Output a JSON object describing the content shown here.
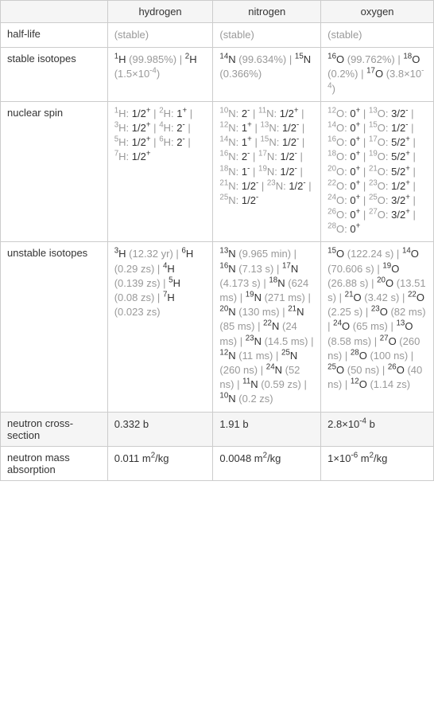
{
  "headers": {
    "hydrogen": "hydrogen",
    "nitrogen": "nitrogen",
    "oxygen": "oxygen"
  },
  "rows": {
    "half_life": {
      "label": "half-life",
      "hydrogen": "(stable)",
      "nitrogen": "(stable)",
      "oxygen": "(stable)"
    },
    "stable_isotopes": {
      "label": "stable isotopes",
      "hydrogen": "¹H (99.985%) | ²H (1.5×10⁻⁴)",
      "nitrogen": "¹⁴N (99.634%) | ¹⁵N (0.366%)",
      "oxygen": "¹⁶O (99.762%) | ¹⁸O (0.2%) | ¹⁷O (3.8×10⁻⁴)"
    },
    "nuclear_spin": {
      "label": "nuclear spin",
      "hydrogen": "¹H: 1/2⁺ | ²H: 1⁺ | ³H: 1/2⁺ | ⁴H: 2⁻ | ⁵H: 1/2⁺ | ⁶H: 2⁻ | ⁷H: 1/2⁺",
      "nitrogen": "¹⁰N: 2⁻ | ¹¹N: 1/2⁺ | ¹²N: 1⁺ | ¹³N: 1/2⁻ | ¹⁴N: 1⁺ | ¹⁵N: 1/2⁻ | ¹⁶N: 2⁻ | ¹⁷N: 1/2⁻ | ¹⁸N: 1⁻ | ¹⁹N: 1/2⁻ | ²¹N: 1/2⁻ | ²³N: 1/2⁻ | ²⁵N: 1/2⁻",
      "oxygen": "¹²O: 0⁺ | ¹³O: 3/2⁻ | ¹⁴O: 0⁺ | ¹⁵O: 1/2⁻ | ¹⁶O: 0⁺ | ¹⁷O: 5/2⁺ | ¹⁸O: 0⁺ | ¹⁹O: 5/2⁺ | ²⁰O: 0⁺ | ²¹O: 5/2⁺ | ²²O: 0⁺ | ²³O: 1/2⁺ | ²⁴O: 0⁺ | ²⁵O: 3/2⁺ | ²⁶O: 0⁺ | ²⁷O: 3/2⁺ | ²⁸O: 0⁺"
    },
    "unstable_isotopes": {
      "label": "unstable isotopes",
      "hydrogen": "³H (12.32 yr) | ⁶H (0.29 zs) | ⁴H (0.139 zs) | ⁵H (0.08 zs) | ⁷H (0.023 zs)",
      "nitrogen": "¹³N (9.965 min) | ¹⁶N (7.13 s) | ¹⁷N (4.173 s) | ¹⁸N (624 ms) | ¹⁹N (271 ms) | ²⁰N (130 ms) | ²¹N (85 ms) | ²²N (24 ms) | ²³N (14.5 ms) | ¹²N (11 ms) | ²⁵N (260 ns) | ²⁴N (52 ns) | ¹¹N (0.59 zs) | ¹⁰N (0.2 zs)",
      "oxygen": "¹⁵O (122.24 s) | ¹⁴O (70.606 s) | ¹⁹O (26.88 s) | ²⁰O (13.51 s) | ²¹O (3.42 s) | ²²O (2.25 s) | ²³O (82 ms) | ²⁴O (65 ms) | ¹³O (8.58 ms) | ²⁷O (260 ns) | ²⁸O (100 ns) | ²⁵O (50 ns) | ²⁶O (40 ns) | ¹²O (1.14 zs)"
    },
    "neutron_cross_section": {
      "label": "neutron cross-section",
      "hydrogen": "0.332 b",
      "nitrogen": "1.91 b",
      "oxygen": "2.8×10⁻⁴ b"
    },
    "neutron_mass_absorption": {
      "label": "neutron mass absorption",
      "hydrogen": "0.011 m²/kg",
      "nitrogen": "0.0048 m²/kg",
      "oxygen": "1×10⁻⁶ m²/kg"
    }
  }
}
